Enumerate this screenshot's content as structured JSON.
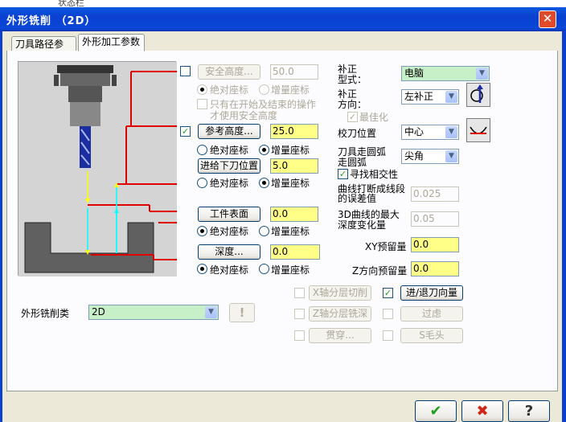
{
  "status_text": "状态栏",
  "window": {
    "title": "外形铣削 （2D）",
    "close": "✕"
  },
  "tabs": [
    "刀具路径参数",
    "外形加工参数"
  ],
  "safety": {
    "label": "安全高度...",
    "value": "50.0",
    "abs": "绝对座标",
    "inc": "增量座标",
    "only_label_1": "只有在开始及结束的操作",
    "only_label_2": "才使用安全高度"
  },
  "ref": {
    "label": "参考高度...",
    "value": "25.0",
    "abs": "绝对座标",
    "inc": "增量座标"
  },
  "feed": {
    "label": "进给下刀位置",
    "value": "5.0",
    "abs": "绝对座标",
    "inc": "增量座标"
  },
  "surface": {
    "label": "工件表面",
    "value": "0.0",
    "abs": "绝对座标",
    "inc": "增量座标"
  },
  "depth": {
    "label": "深度...",
    "value": "0.0",
    "abs": "绝对座标",
    "inc": "增量座标"
  },
  "comp_type": {
    "label_1": "补正",
    "label_2": "型式：",
    "value": "电脑"
  },
  "comp_dir": {
    "label_1": "补正",
    "label_2": "方向：",
    "value": "左补正"
  },
  "optimize": "最佳化",
  "tip": {
    "label": "校刀位置",
    "value": "中心"
  },
  "corner": {
    "label_1": "刀具走圆弧",
    "label_2": "走圆弧",
    "value": "尖角"
  },
  "intersect": "寻找相交性",
  "tol": {
    "label_1": "曲线打断成线段",
    "label_2": "的误差值",
    "value": "0.025"
  },
  "depth3d": {
    "label_1": "3D曲线的最大",
    "label_2": "深度变化量",
    "value": "0.05"
  },
  "xy_stock": {
    "label": "XY预留量",
    "value": "0.0"
  },
  "z_stock": {
    "label": "Z方向预留量",
    "value": "0.0"
  },
  "multi": {
    "x_label": "X轴分层切削",
    "z_label": "Z轴分层铣深",
    "through": "贯穿...",
    "leadio": "进/退刀向量",
    "filter": "过虑",
    "tabs": "S毛头"
  },
  "contour_type": {
    "label": "外形铣削类",
    "value": "2D"
  },
  "buttons": {
    "ok": "✔",
    "cancel": "✖",
    "help": "?"
  },
  "colors": {
    "input_bg": "#ffff88",
    "select_bg": "#c8f0c8",
    "title_bar": "#0a5ae0"
  }
}
